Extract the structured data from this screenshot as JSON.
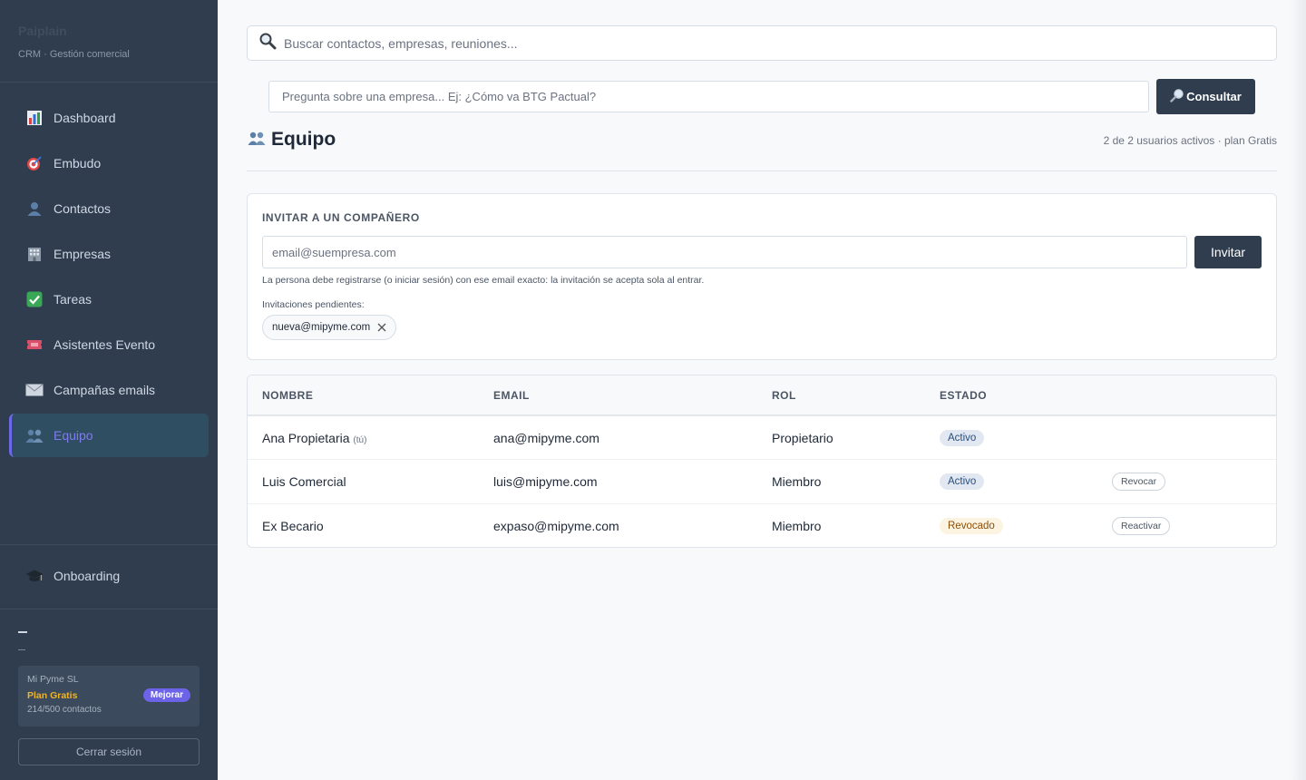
{
  "sidebar": {
    "brand": "Paiplain",
    "brand_sub": "CRM · Gestión comercial",
    "items": [
      {
        "label": "Dashboard",
        "icon": "bar-chart-icon"
      },
      {
        "label": "Embudo",
        "icon": "target-icon"
      },
      {
        "label": "Contactos",
        "icon": "person-icon"
      },
      {
        "label": "Empresas",
        "icon": "building-icon"
      },
      {
        "label": "Tareas",
        "icon": "check-icon"
      },
      {
        "label": "Asistentes Evento",
        "icon": "ticket-icon"
      },
      {
        "label": "Campañas emails",
        "icon": "envelope-icon"
      },
      {
        "label": "Equipo",
        "icon": "people-icon",
        "active": true
      }
    ],
    "onboarding": {
      "label": "Onboarding",
      "icon": "graduation-cap-icon"
    },
    "user_name": "–",
    "user_email": "–",
    "plan": {
      "org": "Mi Pyme SL",
      "name": "Plan Gratis",
      "upgrade": "Mejorar",
      "usage": "214/500 contactos"
    },
    "logout": "Cerrar sesión"
  },
  "search": {
    "placeholder": "Buscar contactos, empresas, reuniones..."
  },
  "ask": {
    "placeholder": "Pregunta sobre una empresa... Ej: ¿Cómo va BTG Pactual?",
    "button": "Consultar"
  },
  "page": {
    "title": "Equipo",
    "meta": "2 de 2 usuarios activos · plan Gratis"
  },
  "invite": {
    "title": "INVITAR A UN COMPAÑERO",
    "placeholder": "email@suempresa.com",
    "button": "Invitar",
    "help": "La persona debe registrarse (o iniciar sesión) con ese email exacto: la invitación se acepta sola al entrar.",
    "pending_label": "Invitaciones pendientes:",
    "pending": [
      "nueva@mipyme.com"
    ]
  },
  "table": {
    "headers": [
      "NOMBRE",
      "EMAIL",
      "ROL",
      "ESTADO",
      ""
    ],
    "rows": [
      {
        "name": "Ana Propietaria",
        "you": "(tú)",
        "email": "ana@mipyme.com",
        "role": "Propietario",
        "status": "Activo",
        "action": ""
      },
      {
        "name": "Luis Comercial",
        "you": "",
        "email": "luis@mipyme.com",
        "role": "Miembro",
        "status": "Activo",
        "action": "Revocar"
      },
      {
        "name": "Ex Becario",
        "you": "",
        "email": "expaso@mipyme.com",
        "role": "Miembro",
        "status": "Revocado",
        "action": "Reactivar"
      }
    ]
  },
  "colors": {
    "sidebar_bg": "#2f3d4f",
    "accent": "#6c63e8",
    "primary_button": "#2f3d4f",
    "badge_active": "#e2e8f2",
    "badge_revoked": "#fdf3e1"
  }
}
